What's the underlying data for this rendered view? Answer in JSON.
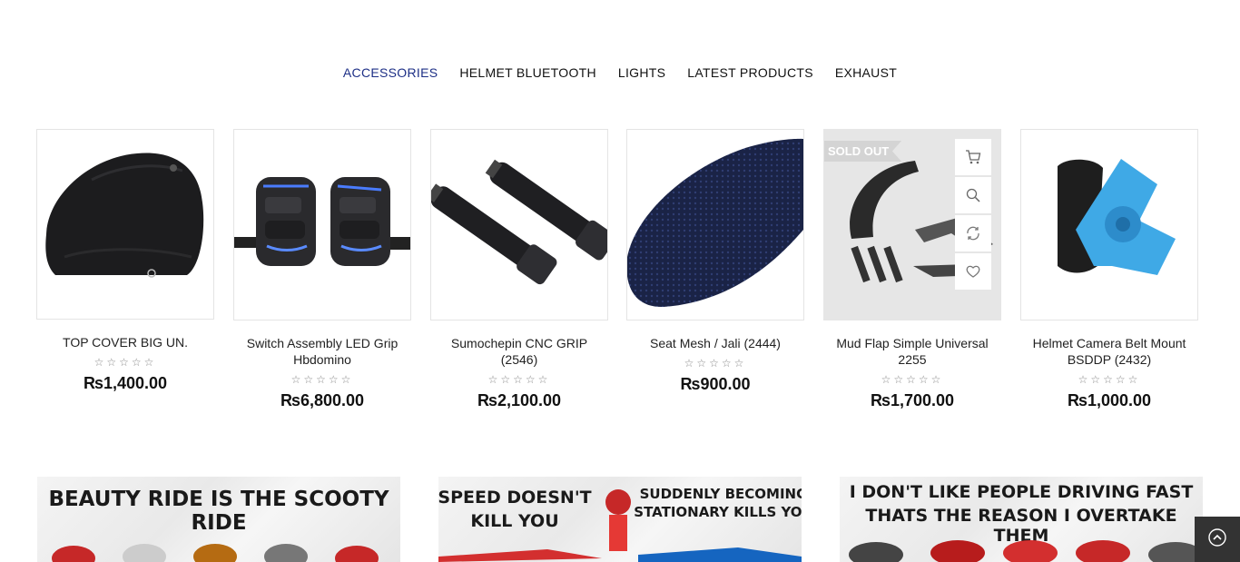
{
  "tabs": [
    {
      "label": "ACCESSORIES",
      "active": true
    },
    {
      "label": "HELMET BLUETOOTH"
    },
    {
      "label": "LIGHTS"
    },
    {
      "label": "LATEST PRODUCTS"
    },
    {
      "label": "EXHAUST"
    }
  ],
  "products": [
    {
      "title": "TOP COVER BIG UN.",
      "rating": "☆☆☆☆☆",
      "price": "₨1,400.00"
    },
    {
      "title": "Switch Assembly LED Grip Hbdomino",
      "rating": "☆☆☆☆☆",
      "price": "₨6,800.00"
    },
    {
      "title": "Sumochepin CNC GRIP (2546)",
      "rating": "☆☆☆☆☆",
      "price": "₨2,100.00"
    },
    {
      "title": "Seat Mesh / Jali (2444)",
      "rating": "☆☆☆☆☆",
      "price": "₨900.00"
    },
    {
      "title": "Mud Flap Simple Universal 2255",
      "rating": "☆☆☆☆☆",
      "price": "₨1,700.00",
      "badge": "SOLD OUT"
    },
    {
      "title": "Helmet Camera Belt Mount BSDDP (2432)",
      "rating": "☆☆☆☆☆",
      "price": "₨1,000.00"
    }
  ],
  "banners": [
    {
      "line1": "BEAUTY RIDE IS THE SCOOTY RIDE"
    },
    {
      "line1": "SPEED DOESN'T",
      "line2": "KILL YOU",
      "line3": "SUDDENLY BECOMING",
      "line4": "STATIONARY KILLS YOU"
    },
    {
      "line1": "I DON'T LIKE PEOPLE DRIVING FAST",
      "line2": "THATS THE REASON I OVERTAKE THEM"
    }
  ],
  "icons": {
    "cart": "cart-icon",
    "search": "search-icon",
    "compare": "compare-icon",
    "wishlist": "heart-icon",
    "scroll_top": "arrow-up-icon"
  },
  "colors": {
    "active_tab": "#1d2f86",
    "scroll_top_bg": "#333333"
  }
}
